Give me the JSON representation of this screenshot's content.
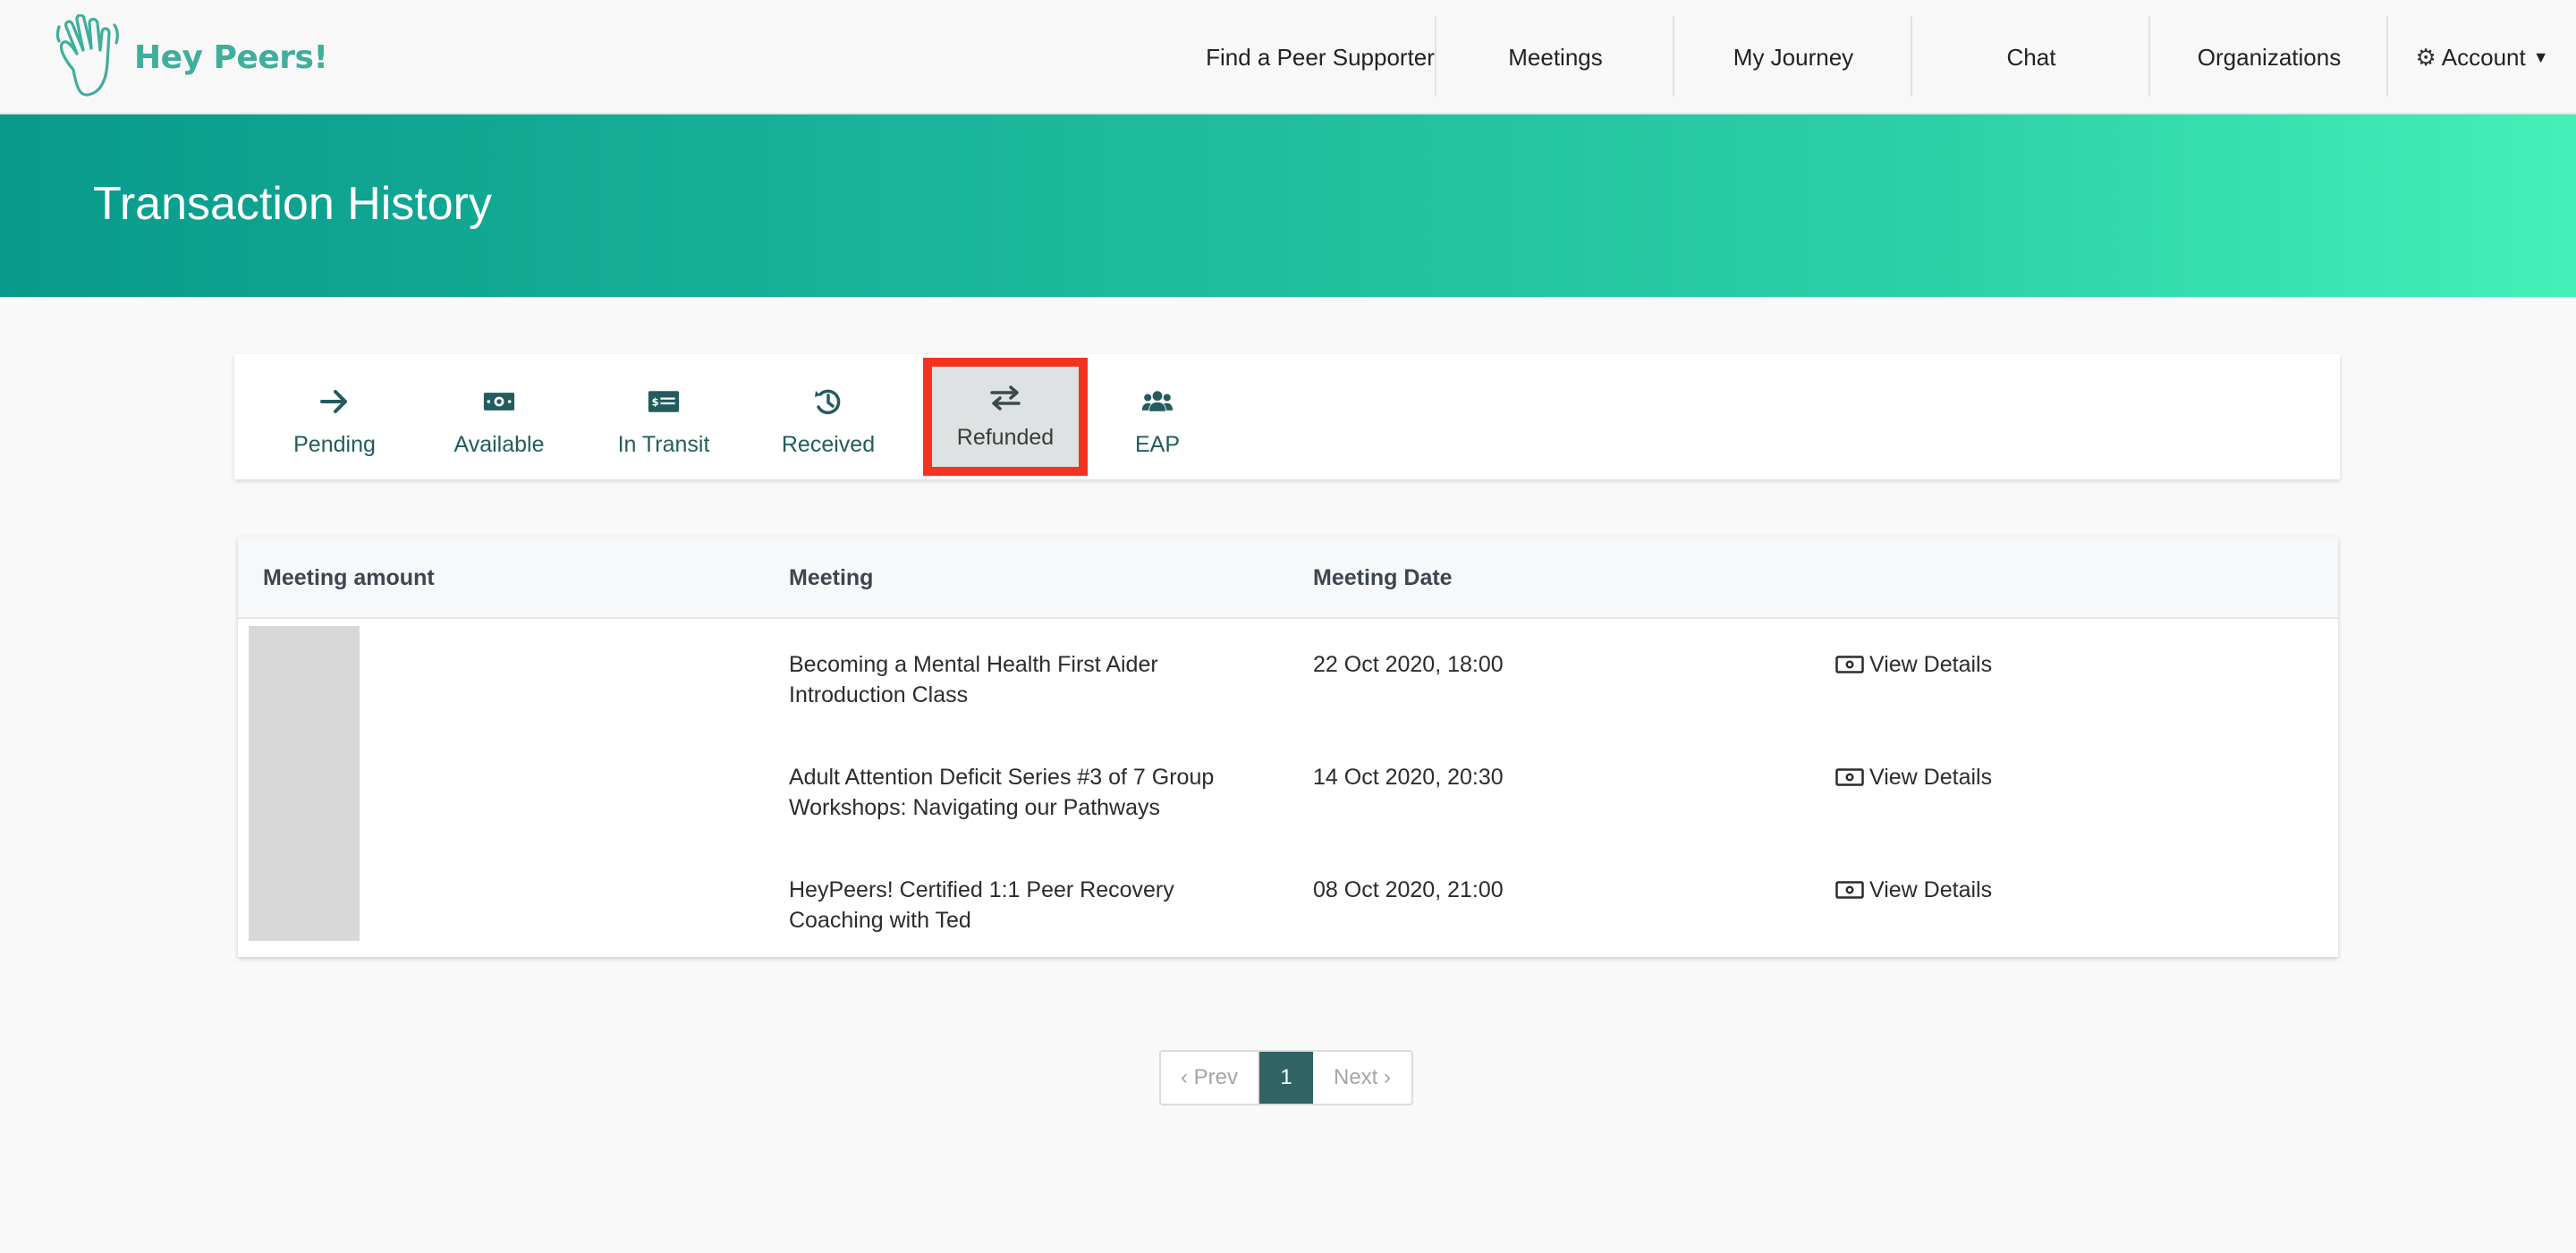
{
  "brand": {
    "name": "Hey Peers!"
  },
  "nav": {
    "items": [
      {
        "label": "Find a Peer Supporter"
      },
      {
        "label": "Meetings"
      },
      {
        "label": "My Journey"
      },
      {
        "label": "Chat"
      },
      {
        "label": "Organizations"
      }
    ],
    "account_label": "Account"
  },
  "banner": {
    "title": "Transaction History"
  },
  "tabs": [
    {
      "label": "Pending",
      "icon": "arrow-right-icon"
    },
    {
      "label": "Available",
      "icon": "money-bill-icon"
    },
    {
      "label": "In Transit",
      "icon": "money-check-icon"
    },
    {
      "label": "Received",
      "icon": "history-icon"
    },
    {
      "label": "Refunded",
      "icon": "exchange-icon",
      "active": true
    },
    {
      "label": "EAP",
      "icon": "users-icon"
    }
  ],
  "table": {
    "headers": {
      "amount": "Meeting amount",
      "meeting": "Meeting",
      "date": "Meeting Date"
    },
    "action_label": "View Details",
    "rows": [
      {
        "meeting_line1": "Becoming a Mental Health First Aider",
        "meeting_line2": "Introduction Class",
        "date": "22 Oct 2020, 18:00"
      },
      {
        "meeting_line1": "Adult Attention Deficit Series #3 of 7 Group",
        "meeting_line2": "Workshops: Navigating our Pathways",
        "date": "14 Oct 2020, 20:30"
      },
      {
        "meeting_line1": "HeyPeers! Certified 1:1 Peer Recovery",
        "meeting_line2": "Coaching with Ted",
        "date": "08 Oct 2020, 21:00"
      }
    ]
  },
  "pagination": {
    "prev": "‹ Prev",
    "current": "1",
    "next": "Next ›"
  },
  "colors": {
    "accent": "#2f6364",
    "banner_start": "#089a8a",
    "banner_end": "#45f0b8",
    "highlight": "#f2331f"
  }
}
